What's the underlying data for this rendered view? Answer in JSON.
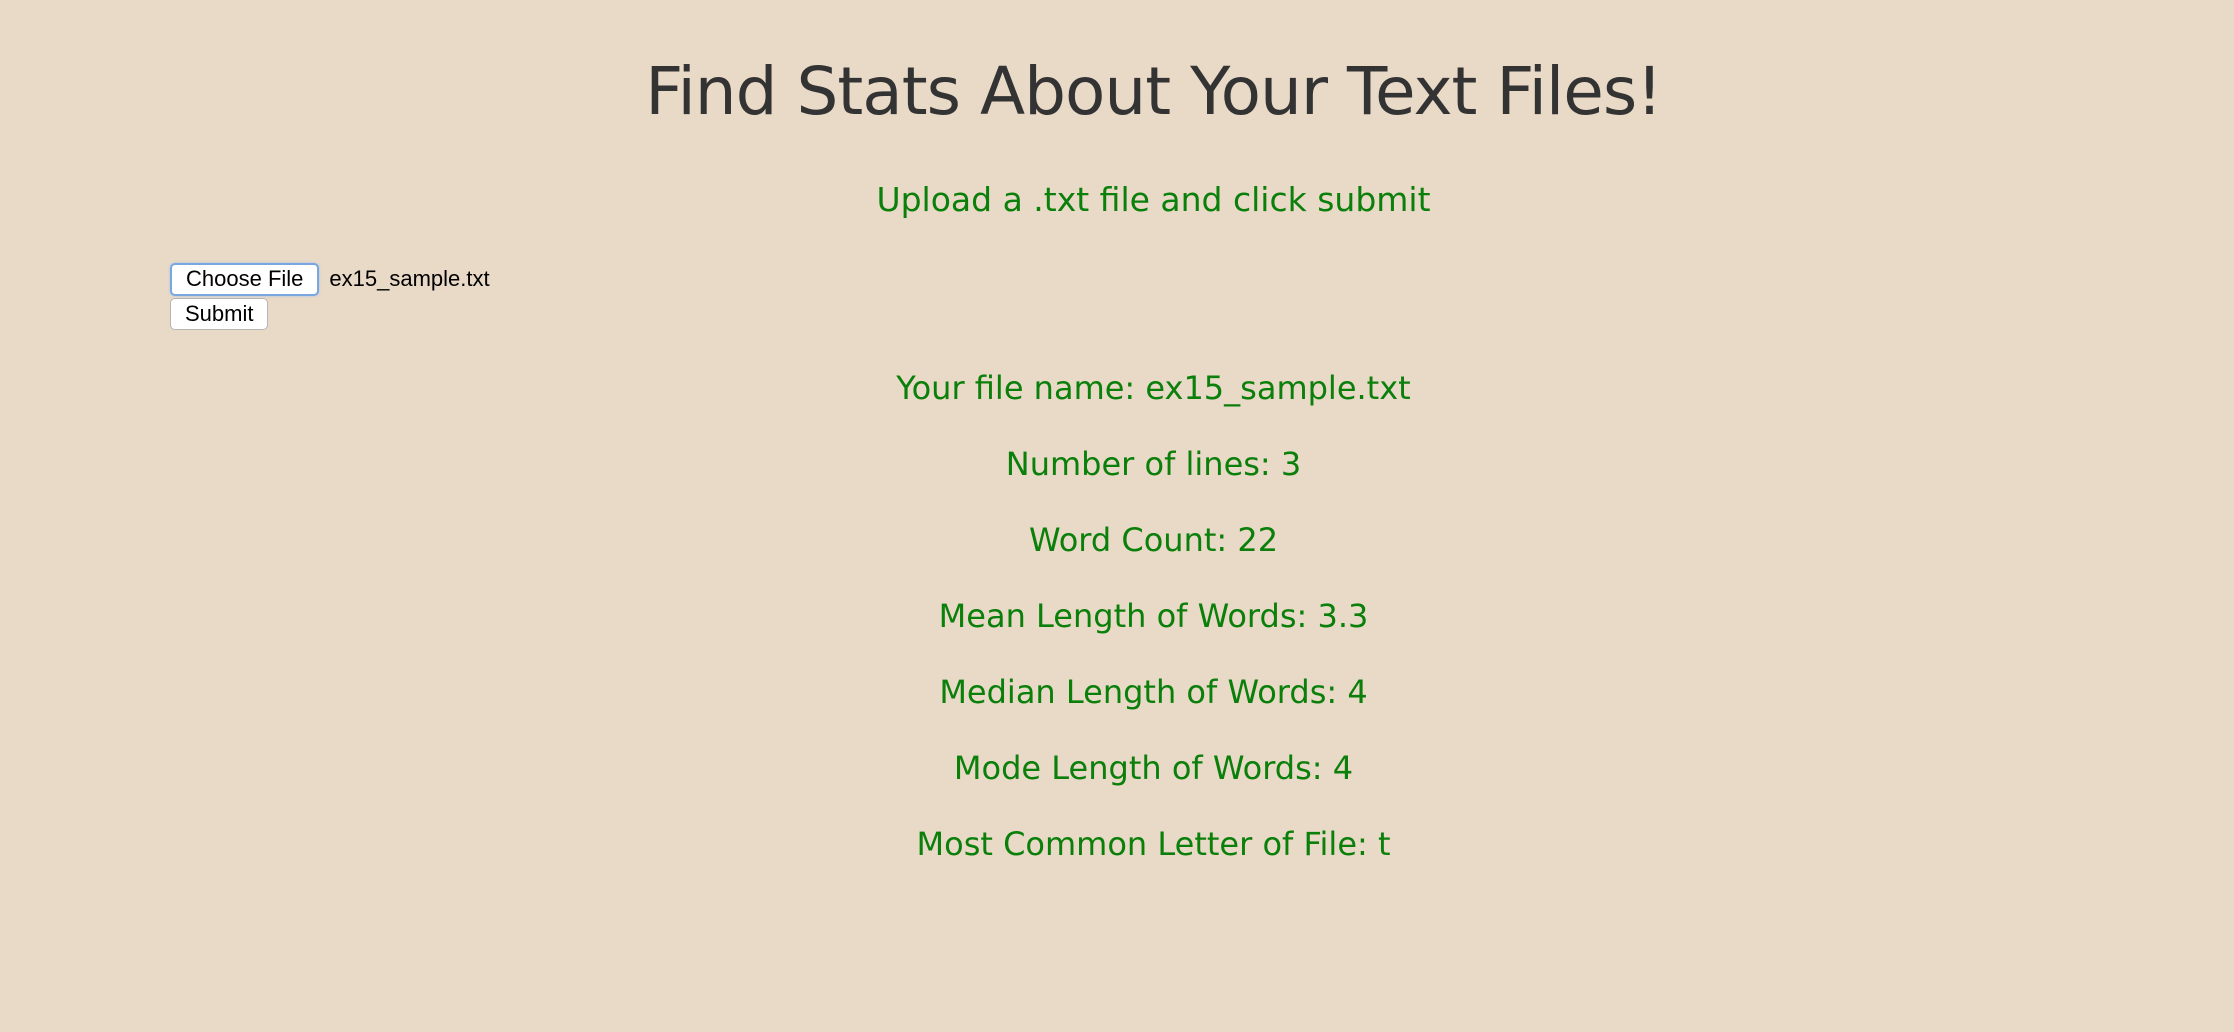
{
  "page": {
    "title": "Find Stats About Your Text Files!",
    "subtitle": "Upload a .txt file and click submit"
  },
  "form": {
    "choose_file_label": "Choose File",
    "selected_file": "ex15_sample.txt",
    "submit_label": "Submit"
  },
  "stats": [
    "Your file name: ex15_sample.txt",
    "Number of lines: 3",
    "Word Count: 22",
    "Mean Length of Words: 3.3",
    "Median Length of Words: 4",
    "Mode Length of Words: 4",
    "Most Common Letter of File: t"
  ],
  "colors": {
    "background": "#e9d9c7",
    "title": "#333333",
    "accent_green": "#0a7f0a",
    "focus_blue": "#7aa7e0"
  }
}
